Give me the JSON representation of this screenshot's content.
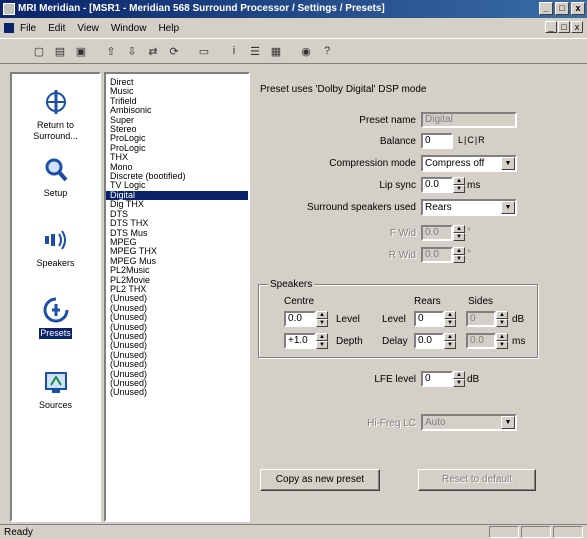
{
  "window": {
    "title": "MRI Meridian - [MSR1 - Meridian 568 Surround Processor / Settings / Presets]",
    "controls": [
      "_",
      "□",
      "x"
    ]
  },
  "menubar": {
    "items": [
      "File",
      "Edit",
      "View",
      "Window",
      "Help"
    ],
    "mdi_controls": [
      "_",
      "□",
      "x"
    ]
  },
  "toolbar": {
    "buttons": [
      "new-icon",
      "open-icon",
      "save-icon",
      "upload-icon",
      "download-icon",
      "compare-icon",
      "sync-icon",
      "remote-icon",
      "info-icon",
      "list-icon",
      "grid-icon",
      "about-icon",
      "help-icon"
    ]
  },
  "nav": {
    "items": [
      {
        "label": "Return to Surround...",
        "icon": "meridian-logo-icon"
      },
      {
        "label": "Setup",
        "icon": "magnifier-icon"
      },
      {
        "label": "Speakers",
        "icon": "speaker-icon"
      },
      {
        "label": "Presets",
        "icon": "presets-icon",
        "active": true
      },
      {
        "label": "Sources",
        "icon": "sources-icon"
      }
    ]
  },
  "presets": {
    "items": [
      "Direct",
      "Music",
      "Trifield",
      "Ambisonic",
      "Super",
      "Stereo",
      "ProLogic",
      "ProLogic",
      "THX",
      "Mono",
      "Discrete (bootified)",
      "TV Logic",
      "Digital",
      "Dig THX",
      "DTS",
      "DTS THX",
      "DTS Mus",
      "MPEG",
      "MPEG THX",
      "MPEG Mus",
      "PL2Music",
      "PL2Movie",
      "PL2 THX",
      "(Unused)",
      "(Unused)",
      "(Unused)",
      "(Unused)",
      "(Unused)",
      "(Unused)",
      "(Unused)",
      "(Unused)",
      "(Unused)",
      "(Unused)",
      "(Unused)"
    ],
    "selected_index": 12
  },
  "settings": {
    "heading": "Preset uses 'Dolby Digital' DSP mode",
    "preset_name_label": "Preset name",
    "preset_name_value": "Digital",
    "balance_label": "Balance",
    "balance_value": "0",
    "balance_marks": "L|C|R",
    "compression_label": "Compression mode",
    "compression_value": "Compress off",
    "lip_sync_label": "Lip sync",
    "lip_sync_value": "0.0",
    "lip_sync_unit": "ms",
    "surround_label": "Surround speakers used",
    "surround_value": "Rears",
    "fld1_label": "F Wid",
    "fld1_value": "0.0",
    "fld2_label": "R Wid",
    "fld2_value": "0.0",
    "unit_deg": "°",
    "speakers": {
      "group_label": "Speakers",
      "centre_label": "Centre",
      "rears_label": "Rears",
      "sides_label": "Sides",
      "centre_level_value": "0.0",
      "centre_depth_value": "+1.0",
      "level_label": "Level",
      "depth_label": "Depth",
      "level_label_2": "Level",
      "delay_label": "Delay",
      "rears_level_value": "0",
      "rears_delay_value": "0.0",
      "sides_level_value": "0",
      "sides_delay_value": "0.0",
      "unit_db": "dB",
      "unit_ms": "ms"
    },
    "lfe_label": "LFE level",
    "lfe_value": "0",
    "lfe_unit": "dB",
    "hi_freq_label": "Hi-Freq LC",
    "hi_freq_value": "Auto",
    "copy_button": "Copy as new preset",
    "reset_button": "Reset to default"
  },
  "status": {
    "text": "Ready"
  }
}
